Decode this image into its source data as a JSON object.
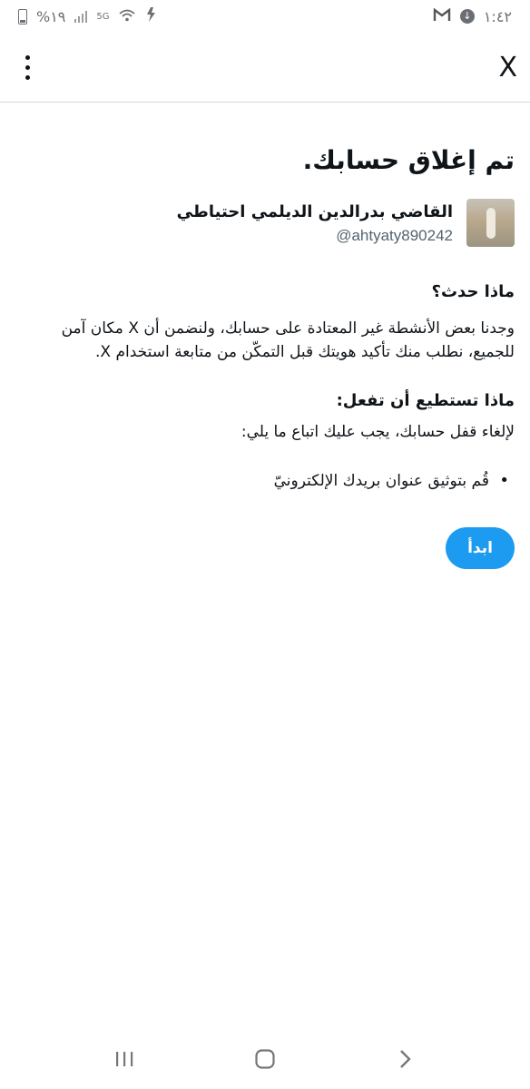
{
  "status_bar": {
    "time": "١:٤٢",
    "battery": "%١٩",
    "network": "5G",
    "mail_icon": "gmail-icon",
    "download_icon": "download-icon"
  },
  "topbar": {
    "logo": "X",
    "menu_icon": "more-vertical-icon"
  },
  "page": {
    "title": "تم إغلاق حسابك.",
    "user": {
      "name": "القاضي بدرالدين الديلمي احتياطي",
      "handle": "@ahtyaty890242"
    },
    "what_happened": {
      "heading": "ماذا حدث؟",
      "body": "وجدنا بعض الأنشطة غير المعتادة على حسابك، ولنضمن أن X مكان آمن للجميع، نطلب منك تأكيد هويتك قبل التمكّن من متابعة استخدام X."
    },
    "what_you_can_do": {
      "heading": "ماذا تستطيع أن تفعل:",
      "body": "لإلغاء قفل حسابك، يجب عليك اتباع ما يلي:",
      "steps": [
        "قُم بتوثيق عنوان بريدك الإلكترونيّ"
      ]
    },
    "start_button": "ابدأ"
  },
  "nav": {
    "recents_icon": "recent-apps-icon",
    "home_icon": "home-icon",
    "back_icon": "back-icon"
  },
  "colors": {
    "accent": "#1d9bf0",
    "text": "#0f1419",
    "secondary_text": "#536471",
    "divider": "#cfd9de"
  }
}
